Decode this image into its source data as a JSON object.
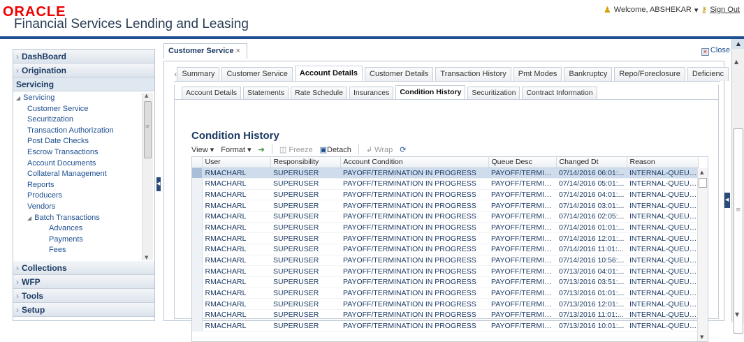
{
  "header": {
    "brand": "ORACLE",
    "product": "Financial Services Lending and Leasing",
    "welcome": "Welcome, ABSHEKAR",
    "sign_out": "Sign Out"
  },
  "nav": {
    "top": [
      {
        "label": "DashBoard"
      },
      {
        "label": "Origination"
      }
    ],
    "section_open": "Servicing",
    "tree": [
      {
        "label": "Servicing",
        "level": "l0"
      },
      {
        "label": "Customer Service",
        "level": "l1b"
      },
      {
        "label": "Securitization",
        "level": "l1b"
      },
      {
        "label": "Transaction Authorization",
        "level": "l1b"
      },
      {
        "label": "Post Date Checks",
        "level": "l1b"
      },
      {
        "label": "Escrow Transactions",
        "level": "l1b"
      },
      {
        "label": "Account Documents",
        "level": "l1b"
      },
      {
        "label": "Collateral Management",
        "level": "l1b"
      },
      {
        "label": "Reports",
        "level": "l1b"
      },
      {
        "label": "Producers",
        "level": "l1b"
      },
      {
        "label": "Vendors",
        "level": "l1b"
      },
      {
        "label": "Batch Transactions",
        "level": "l1b"
      },
      {
        "label": "Advances",
        "level": "l2"
      },
      {
        "label": "Payments",
        "level": "l2"
      },
      {
        "label": "Fees",
        "level": "l2"
      }
    ],
    "bottom": [
      {
        "label": "Collections"
      },
      {
        "label": "WFP"
      },
      {
        "label": "Tools"
      },
      {
        "label": "Setup"
      }
    ]
  },
  "main": {
    "tab_title": "Customer Service",
    "close_label": "Close",
    "tabs": [
      "Summary",
      "Customer Service",
      "Account Details",
      "Customer Details",
      "Transaction History",
      "Pmt Modes",
      "Bankruptcy",
      "Repo/Foreclosure",
      "Deficienc"
    ],
    "active_tab": "Account Details",
    "subtabs": [
      "Account Details",
      "Statements",
      "Rate Schedule",
      "Insurances",
      "Condition History",
      "Securitization",
      "Contract Information"
    ],
    "active_subtab": "Condition History",
    "section_title": "Condition History",
    "toolbar": {
      "view": "View",
      "format": "Format",
      "freeze": "Freeze",
      "detach": "Detach",
      "wrap": "Wrap"
    },
    "table": {
      "columns": [
        "User",
        "Responsibility",
        "Account Condition",
        "Queue Desc",
        "Changed Dt",
        "Reason"
      ],
      "rows": [
        [
          "RMACHARL",
          "SUPERUSER",
          "PAYOFF/TERMINATION IN PROGRESS",
          "PAYOFF/TERMINA...",
          "07/14/2016 06:01:...",
          "INTERNAL-QUEUE ..."
        ],
        [
          "RMACHARL",
          "SUPERUSER",
          "PAYOFF/TERMINATION IN PROGRESS",
          "PAYOFF/TERMINA...",
          "07/14/2016 05:01:...",
          "INTERNAL-QUEUE ..."
        ],
        [
          "RMACHARL",
          "SUPERUSER",
          "PAYOFF/TERMINATION IN PROGRESS",
          "PAYOFF/TERMINA...",
          "07/14/2016 04:01:...",
          "INTERNAL-QUEUE ..."
        ],
        [
          "RMACHARL",
          "SUPERUSER",
          "PAYOFF/TERMINATION IN PROGRESS",
          "PAYOFF/TERMINA...",
          "07/14/2016 03:01:...",
          "INTERNAL-QUEUE ..."
        ],
        [
          "RMACHARL",
          "SUPERUSER",
          "PAYOFF/TERMINATION IN PROGRESS",
          "PAYOFF/TERMINA...",
          "07/14/2016 02:05:...",
          "INTERNAL-QUEUE ..."
        ],
        [
          "RMACHARL",
          "SUPERUSER",
          "PAYOFF/TERMINATION IN PROGRESS",
          "PAYOFF/TERMINA...",
          "07/14/2016 01:01:...",
          "INTERNAL-QUEUE ..."
        ],
        [
          "RMACHARL",
          "SUPERUSER",
          "PAYOFF/TERMINATION IN PROGRESS",
          "PAYOFF/TERMINA...",
          "07/14/2016 12:01:...",
          "INTERNAL-QUEUE ..."
        ],
        [
          "RMACHARL",
          "SUPERUSER",
          "PAYOFF/TERMINATION IN PROGRESS",
          "PAYOFF/TERMINA...",
          "07/14/2016 11:01:...",
          "INTERNAL-QUEUE ..."
        ],
        [
          "RMACHARL",
          "SUPERUSER",
          "PAYOFF/TERMINATION IN PROGRESS",
          "PAYOFF/TERMINA...",
          "07/14/2016 10:56:...",
          "INTERNAL-QUEUE ..."
        ],
        [
          "RMACHARL",
          "SUPERUSER",
          "PAYOFF/TERMINATION IN PROGRESS",
          "PAYOFF/TERMINA...",
          "07/13/2016 04:01:...",
          "INTERNAL-QUEUE ..."
        ],
        [
          "RMACHARL",
          "SUPERUSER",
          "PAYOFF/TERMINATION IN PROGRESS",
          "PAYOFF/TERMINA...",
          "07/13/2016 03:51:...",
          "INTERNAL-QUEUE ..."
        ],
        [
          "RMACHARL",
          "SUPERUSER",
          "PAYOFF/TERMINATION IN PROGRESS",
          "PAYOFF/TERMINA...",
          "07/13/2016 01:01:...",
          "INTERNAL-QUEUE ..."
        ],
        [
          "RMACHARL",
          "SUPERUSER",
          "PAYOFF/TERMINATION IN PROGRESS",
          "PAYOFF/TERMINA...",
          "07/13/2016 12:01:...",
          "INTERNAL-QUEUE ..."
        ],
        [
          "RMACHARL",
          "SUPERUSER",
          "PAYOFF/TERMINATION IN PROGRESS",
          "PAYOFF/TERMINA...",
          "07/13/2016 11:01:...",
          "INTERNAL-QUEUE ..."
        ],
        [
          "RMACHARL",
          "SUPERUSER",
          "PAYOFF/TERMINATION IN PROGRESS",
          "PAYOFF/TERMINA...",
          "07/13/2016 10:01:...",
          "INTERNAL-QUEUE ..."
        ]
      ]
    }
  },
  "colors": {
    "brand_red": "#e00000",
    "header_bar": "#1d4f91",
    "link_blue": "#1d4f91",
    "selected_row": "#cfdcec"
  }
}
